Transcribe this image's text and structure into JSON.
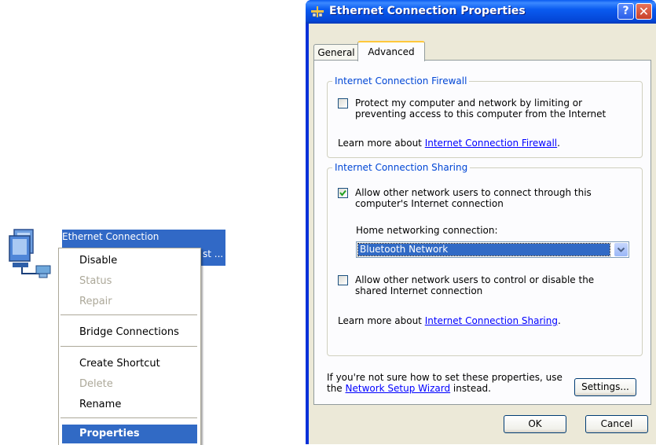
{
  "connection": {
    "name": "Ethernet Connection",
    "trail": "st ..."
  },
  "context_menu": {
    "items": [
      {
        "label": "Disable",
        "enabled": true
      },
      {
        "label": "Status",
        "enabled": false
      },
      {
        "label": "Repair",
        "enabled": false
      },
      {
        "label": "Bridge Connections",
        "enabled": true
      },
      {
        "label": "Create Shortcut",
        "enabled": true
      },
      {
        "label": "Delete",
        "enabled": false
      },
      {
        "label": "Rename",
        "enabled": true
      },
      {
        "label": "Properties",
        "enabled": true,
        "selected": true
      }
    ]
  },
  "dialog": {
    "title": "Ethernet Connection Properties",
    "help_glyph": "?",
    "close_glyph": "✕",
    "tabs": [
      {
        "label": "General",
        "active": false
      },
      {
        "label": "Advanced",
        "active": true
      }
    ],
    "firewall": {
      "legend": "Internet Connection Firewall",
      "checkbox_label": "Protect my computer and network by limiting or preventing access to this computer from the Internet",
      "checked": false,
      "learn_prefix": "Learn more about ",
      "learn_link": "Internet Connection Firewall",
      "learn_suffix": "."
    },
    "sharing": {
      "legend": "Internet Connection Sharing",
      "allow_connect_label": "Allow other network users to connect through this computer's Internet connection",
      "allow_connect_checked": true,
      "home_label": "Home networking connection:",
      "home_value": "Bluetooth Network",
      "allow_control_label": "Allow other network users to control or disable the shared Internet connection",
      "allow_control_checked": false,
      "learn_prefix": "Learn more about ",
      "learn_link": "Internet Connection Sharing",
      "learn_suffix": "."
    },
    "footer": {
      "line1": "If you're not sure how to set these properties, use",
      "line2_prefix": "the ",
      "line2_link": "Network Setup Wizard",
      "line2_suffix": " instead.",
      "settings_label": "Settings..."
    },
    "ok_label": "OK",
    "cancel_label": "Cancel"
  },
  "colors": {
    "selection": "#316ac5",
    "titlebar": "#0a5bf0",
    "legend": "#0046d5",
    "dialog_face": "#ece9d8"
  }
}
